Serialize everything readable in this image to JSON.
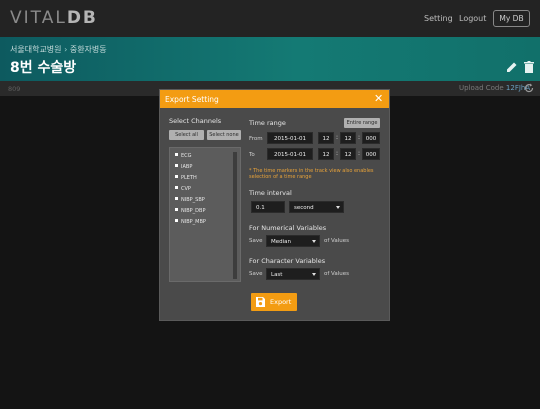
{
  "nav": {
    "logo_main": "VITAL",
    "logo_accent": "DB",
    "setting": "Setting",
    "logout": "Logout",
    "mydb": "My DB"
  },
  "header": {
    "breadcrumb_1": "서울대학교병원",
    "breadcrumb_2": "중환자병동",
    "room": "8번 수술방"
  },
  "subbar": {
    "left_text": "809",
    "upload_label": "Upload Code",
    "upload_code": "12FJhA"
  },
  "modal": {
    "title": "Export Setting",
    "close": "✕",
    "select_channels": "Select Channels",
    "select_all": "Select all",
    "select_none": "Select none",
    "channels": [
      "ECG",
      "IABP",
      "PLETH",
      "CVP",
      "NIBP_SBP",
      "NIBP_DBP",
      "NIBP_MBP"
    ],
    "time_range": "Time range",
    "entire_range": "Entire range",
    "from_label": "From",
    "to_label": "To",
    "from": {
      "date": "2015-01-01",
      "hh": "12",
      "mm": "12",
      "sss": "000"
    },
    "to": {
      "date": "2015-01-01",
      "hh": "12",
      "mm": "12",
      "sss": "000"
    },
    "hint": "* The time markers in the track view also enables selection of a time range",
    "time_interval": "Time interval",
    "interval_value": "0.1",
    "interval_unit": "second",
    "numerical_title": "For Numerical Variables",
    "save_label": "Save",
    "numerical_value": "Median",
    "of_values": "of Values",
    "character_title": "For Character Variables",
    "character_value": "Last",
    "export": "Export"
  },
  "colors": {
    "accent": "#f39c12",
    "band": "#147a74",
    "modal_bg": "#4a4a4a"
  },
  "icons": [
    "edit-icon",
    "trash-icon",
    "refresh-icon",
    "close-icon",
    "save-icon"
  ]
}
